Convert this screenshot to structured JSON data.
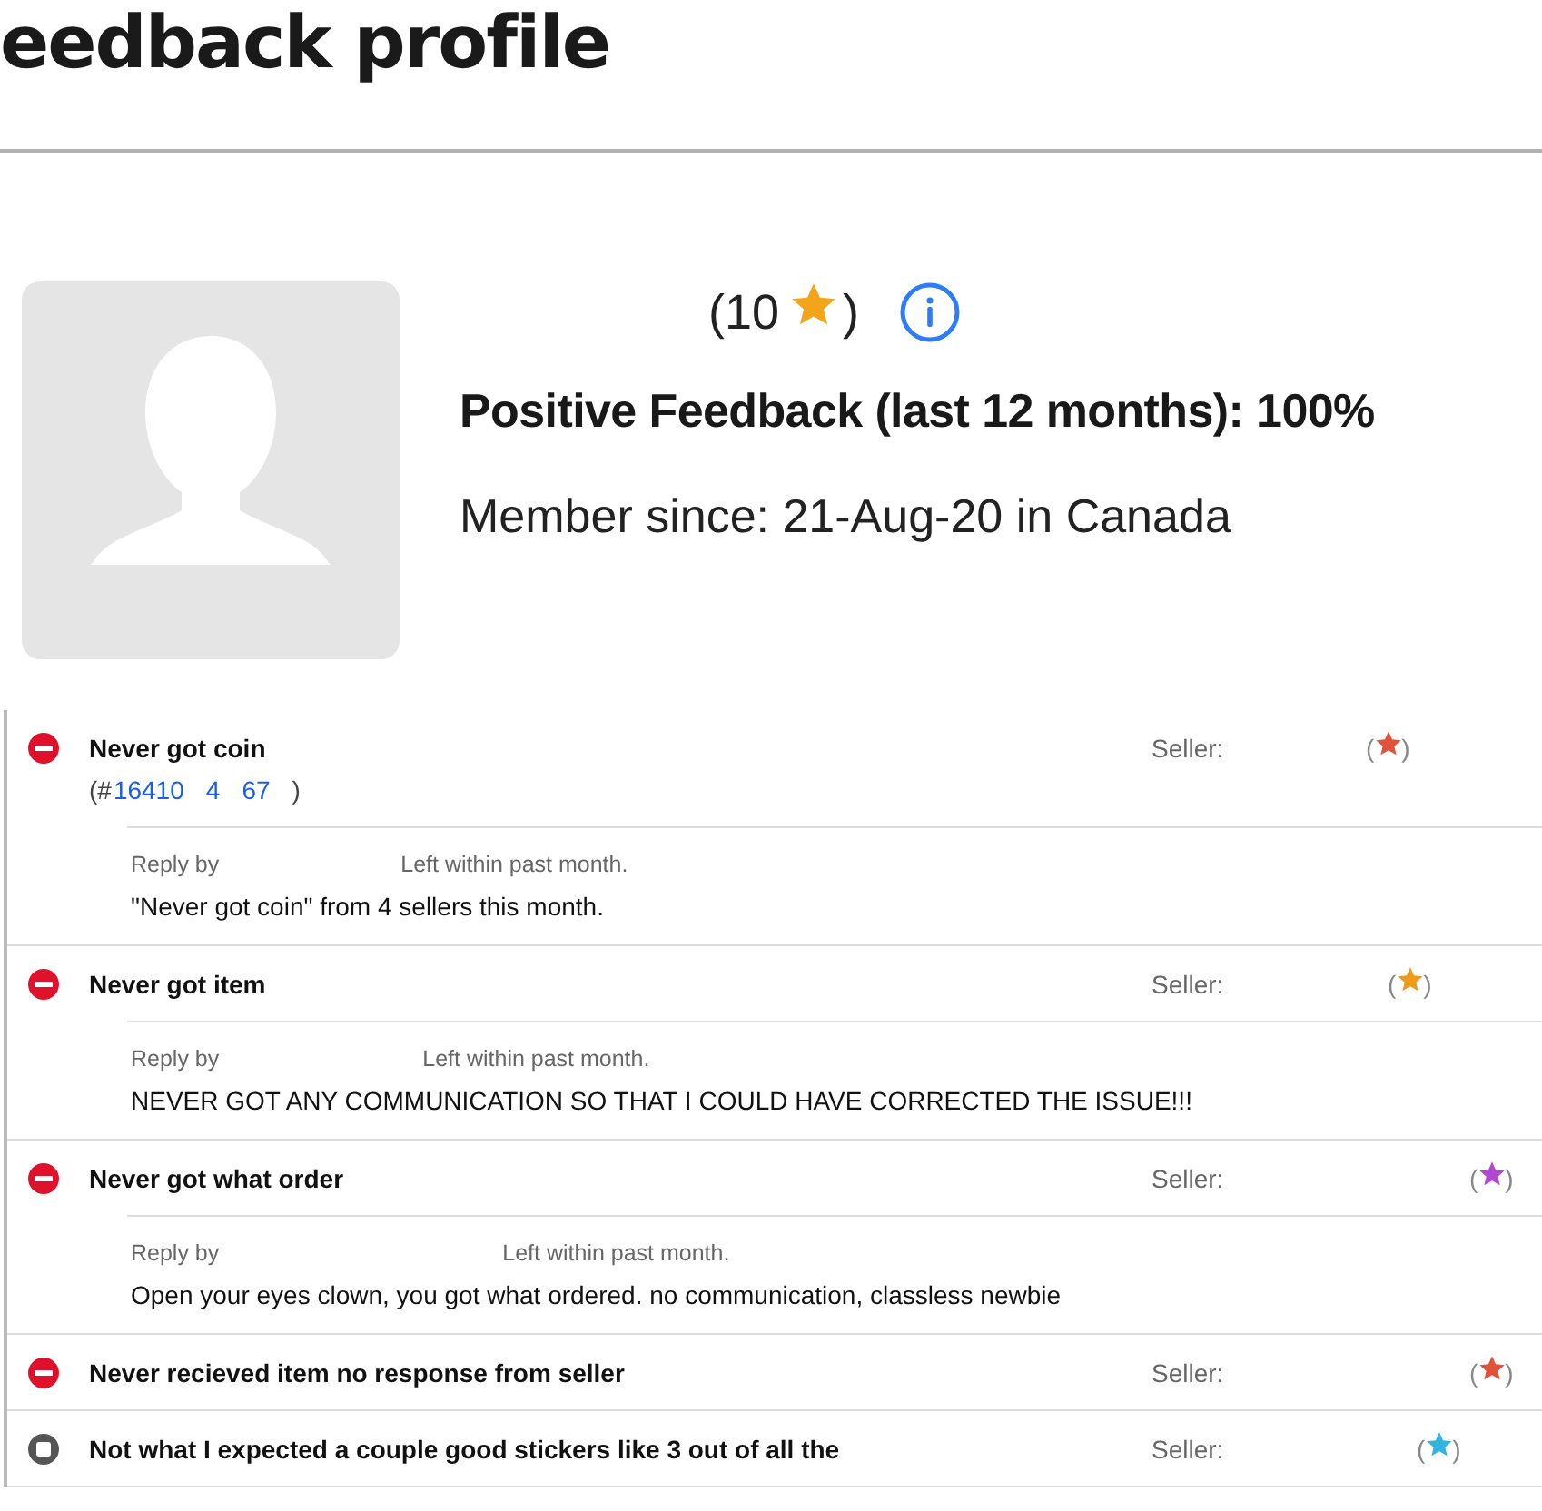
{
  "page_title": "eedback profile",
  "profile": {
    "score_open": "(10",
    "score_close": ")",
    "positive": "Positive Feedback (last 12 months): 100%",
    "member_since": "Member since: 21-Aug-20 in Canada"
  },
  "feedback": [
    {
      "kind": "negative",
      "comment": "Never got coin",
      "seller_label": "Seller:",
      "seller_open": "(",
      "seller_close": ")",
      "color": "#e0523a",
      "order": {
        "prefix": "(#",
        "links": [
          "16410",
          "4",
          "67"
        ],
        "suffix": ")"
      },
      "reply": {
        "by": "Reply by",
        "time": "Left within past month.",
        "text": "\"Never got coin\" from 4 sellers this month."
      }
    },
    {
      "kind": "negative",
      "comment": "Never got item",
      "seller_label": "Seller:",
      "seller_open": "(",
      "seller_close": ")",
      "color": "#f09a1a",
      "reply": {
        "by": "Reply by",
        "time": "Left within past month.",
        "text": "NEVER GOT ANY COMMUNICATION SO THAT I COULD HAVE CORRECTED THE ISSUE!!!"
      }
    },
    {
      "kind": "negative",
      "comment": "Never got what order",
      "seller_label": "Seller:",
      "seller_open": "(",
      "seller_close": ")",
      "color": "#b048d0",
      "reply": {
        "by": "Reply by",
        "time": "Left within past month.",
        "text": "Open your eyes clown, you got what ordered. no communication, classless newbie"
      }
    },
    {
      "kind": "negative",
      "comment": "Never recieved item no response from seller",
      "seller_label": "Seller:",
      "seller_open": "(",
      "seller_close": ")",
      "color": "#e0523a"
    },
    {
      "kind": "neutral",
      "comment": "Not what I expected a couple good stickers like 3 out of all the",
      "seller_label": "Seller:",
      "seller_open": "(",
      "seller_close": ")",
      "color": "#30b4e0"
    }
  ]
}
